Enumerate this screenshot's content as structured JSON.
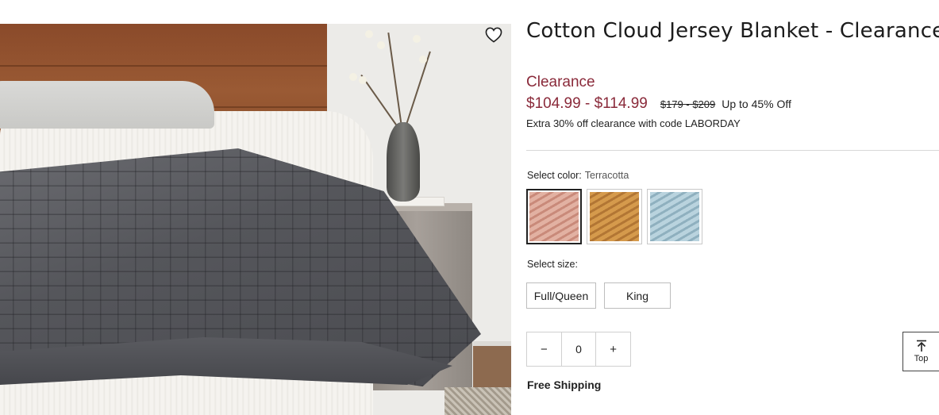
{
  "product": {
    "title": "Cotton Cloud Jersey Blanket - Clearance",
    "clearance_label": "Clearance",
    "price_current": "$104.99 - $114.99",
    "price_original": "$179 - $209",
    "discount_text": "Up to 45% Off",
    "promo_text": "Extra 30% off clearance with code LABORDAY"
  },
  "color": {
    "label": "Select color:",
    "selected": "Terracotta",
    "swatches": [
      {
        "name": "Terracotta",
        "color": "#d9a191",
        "selected": true
      },
      {
        "name": "Ochre",
        "color": "#c98a3e",
        "selected": false
      },
      {
        "name": "Blue",
        "color": "#a9c6d3",
        "selected": false
      }
    ]
  },
  "size": {
    "label": "Select size:",
    "options": [
      "Full/Queen",
      "King"
    ]
  },
  "quantity": {
    "decrement": "−",
    "value": "0",
    "increment": "+"
  },
  "shipping": "Free Shipping",
  "scroll_top": {
    "label": "Top",
    "icon": "arrow-up-to-line-icon"
  },
  "favorite_icon": "heart-outline-icon",
  "colors": {
    "clearance": "#8a2a3a",
    "text": "#222222",
    "divider": "#d8d8d8"
  }
}
